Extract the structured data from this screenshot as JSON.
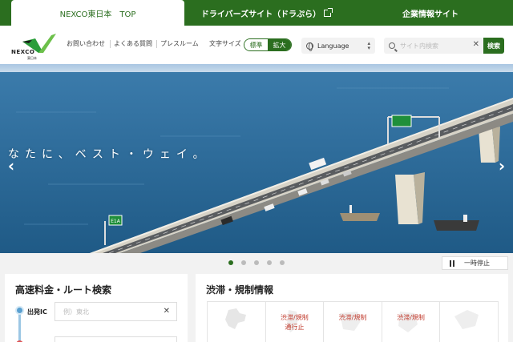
{
  "top_tabs": {
    "nexco_top": "NEXCO東日本　TOP",
    "drivers": "ドライバーズサイト（ドラぷら）",
    "corporate": "企業情報サイト"
  },
  "header": {
    "logo_text": "NEXCO",
    "logo_sub": "東日本",
    "links": [
      "お問い合わせ",
      "よくある質問",
      "プレスルーム"
    ],
    "font_size_label": "文字サイズ",
    "font_size_standard": "標準",
    "font_size_large": "拡大",
    "language": "Language",
    "search_placeholder": "サイト内検索",
    "search_button": "検索"
  },
  "hero": {
    "catchphrase": "なたに、ベスト・ウェイ。",
    "sign_text": "E1A",
    "prev_arrow": "‹",
    "next_arrow": "›"
  },
  "carousel": {
    "slide_count": 5,
    "active_index": 0,
    "pause_label": "一時停止"
  },
  "route_search": {
    "title": "高速料金・ルート検索",
    "departure_label": "出発IC",
    "departure_placeholder": "例）東北"
  },
  "traffic": {
    "title": "渋滞・規制情報",
    "regions": [
      {
        "warning_line1": "",
        "warning_line2": ""
      },
      {
        "warning_line1": "渋滞/規制",
        "warning_line2": "通行止"
      },
      {
        "warning_line1": "渋滞/規制",
        "warning_line2": ""
      },
      {
        "warning_line1": "渋滞/規制",
        "warning_line2": ""
      },
      {
        "warning_line1": "",
        "warning_line2": ""
      }
    ]
  },
  "colors": {
    "brand_green": "#2b6e1f",
    "warning_red": "#c0392b",
    "sea_blue": "#2e6c99"
  }
}
